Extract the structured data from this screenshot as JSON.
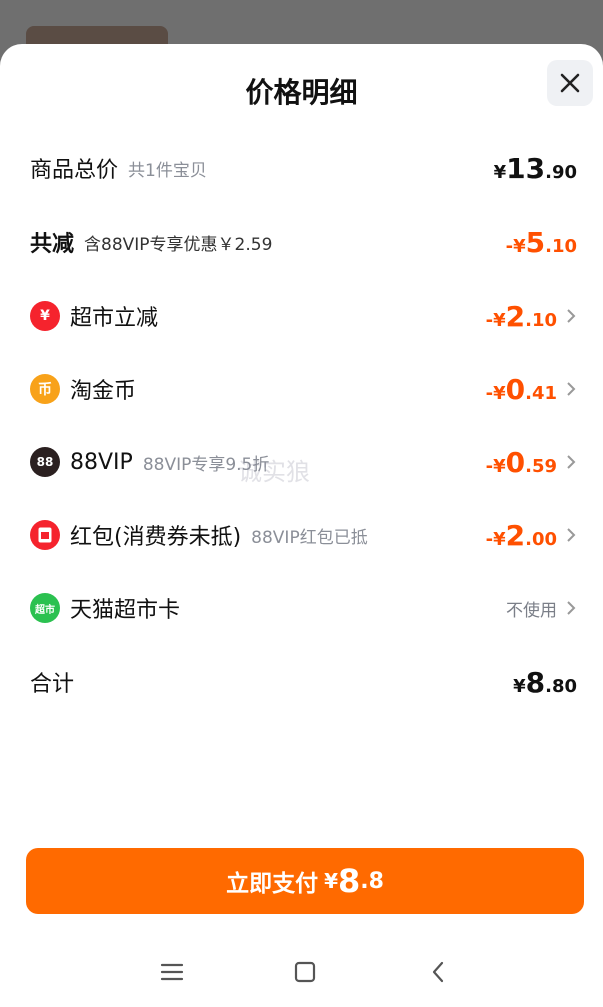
{
  "sheet": {
    "title": "价格明细"
  },
  "rows": {
    "total": {
      "label": "商品总价",
      "sub": "共1件宝贝",
      "yen": "¥",
      "int": "13",
      "dec": ".90"
    },
    "discount": {
      "label": "共减",
      "sub": "含88VIP专享优惠￥2.59",
      "sign": "-¥",
      "int": "5",
      "dec": ".10"
    },
    "supermarket": {
      "label": "超市立减",
      "sign": "-¥",
      "int": "2",
      "dec": ".10",
      "icon_glyph": "¥"
    },
    "coins": {
      "label": "淘金币",
      "sign": "-¥",
      "int": "0",
      "dec": ".41",
      "icon_glyph": "币"
    },
    "vip": {
      "label": "88VIP",
      "sub": "88VIP专享9.5折",
      "sign": "-¥",
      "int": "0",
      "dec": ".59",
      "icon_glyph": "88"
    },
    "redpacket": {
      "label": "红包(消费券未抵)",
      "sub": "88VIP红包已抵",
      "sign": "-¥",
      "int": "2",
      "dec": ".00"
    },
    "tmallcard": {
      "label": "天猫超市卡",
      "status": "不使用",
      "icon_glyph": "超市"
    },
    "sum": {
      "label": "合计",
      "yen": "¥",
      "int": "8",
      "dec": ".80"
    }
  },
  "pay_button": {
    "label": "立即支付",
    "yen": "¥",
    "int": "8",
    "dec": ".8"
  },
  "watermark": "诚实狼",
  "colors": {
    "accent": "#ff6a00",
    "discount": "#ff5000"
  }
}
